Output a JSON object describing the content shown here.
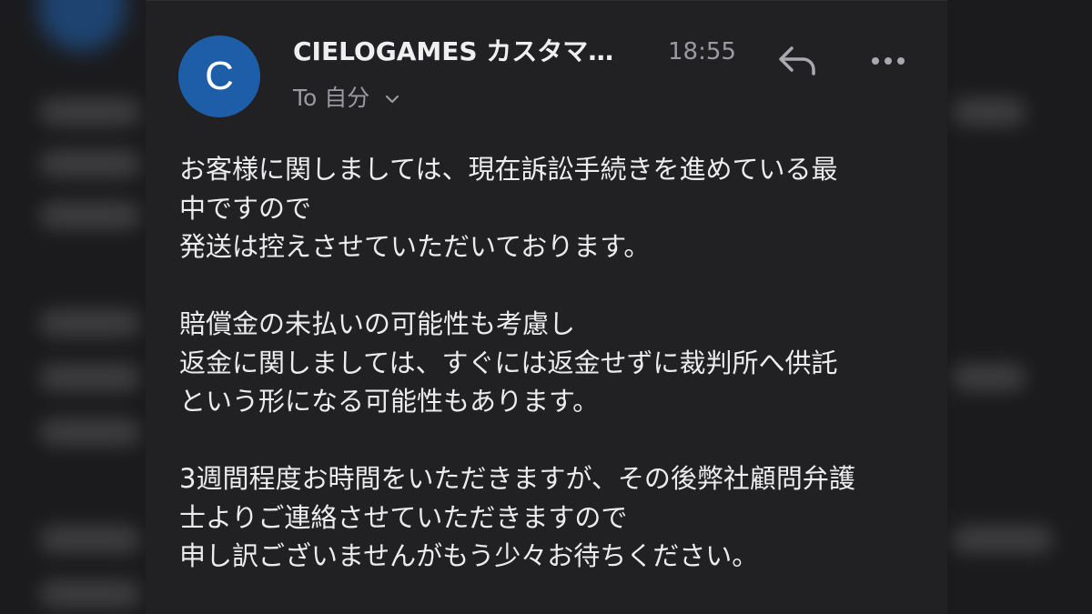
{
  "email": {
    "sender_initial": "C",
    "sender_name": "CIELOGAMES カスタマ…",
    "time": "18:55",
    "recipient_prefix": "To",
    "recipient_name": "自分",
    "reply_icon": "reply-icon",
    "more_icon": "more-icon",
    "avatar_color": "#1e5ea8",
    "body_paragraphs": [
      [
        "お客様に関しましては、現在訴訟手続きを進めている最",
        "中ですので",
        "発送は控えさせていただいております。"
      ],
      [
        "賠償金の未払いの可能性も考慮し",
        "返金に関しましては、すぐには返金せずに裁判所へ供託",
        "という形になる可能性もあります。"
      ],
      [
        "3週間程度お時間をいただきますが、その後弊社顧問弁護",
        "士よりご連絡させていただきますので",
        "申し訳ございませんがもう少々お待ちください。"
      ]
    ]
  }
}
